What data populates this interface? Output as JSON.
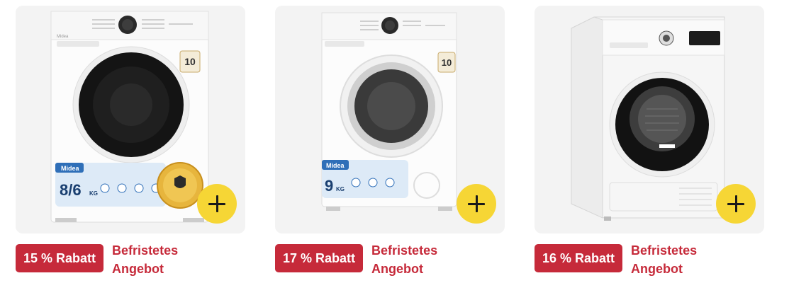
{
  "products": [
    {
      "discount": "15 % Rabatt",
      "offer": [
        "Befristetes",
        "Angebot"
      ],
      "brand": "Midea",
      "capacity": "8/6",
      "capacity_unit": "KG"
    },
    {
      "discount": "17 % Rabatt",
      "offer": [
        "Befristetes",
        "Angebot"
      ],
      "brand": "Midea",
      "capacity": "9",
      "capacity_unit": "KG"
    },
    {
      "discount": "16 % Rabatt",
      "offer": [
        "Befristetes",
        "Angebot"
      ]
    }
  ],
  "colors": {
    "accent": "#c62a3a",
    "add_button": "#f6d635",
    "card_bg": "#f3f3f3"
  },
  "icons": {
    "add": "plus-icon"
  }
}
